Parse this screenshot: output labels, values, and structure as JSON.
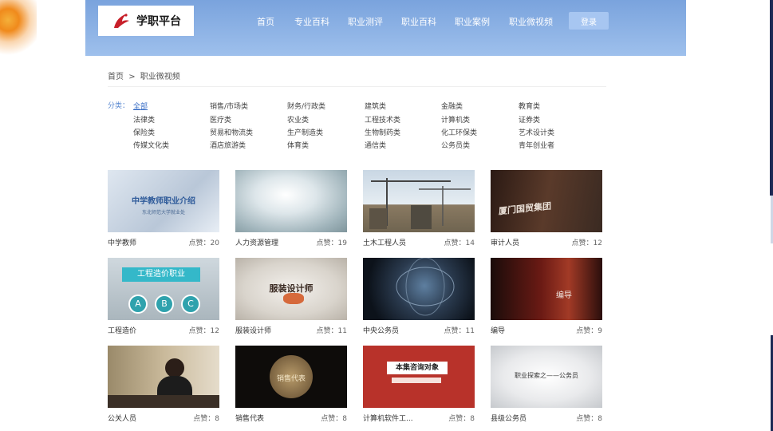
{
  "header": {
    "logo_text": "学职平台",
    "nav": [
      "首页",
      "专业百科",
      "职业测评",
      "职业百科",
      "职业案例",
      "职业微视频"
    ],
    "login_label": "登录"
  },
  "breadcrumb": {
    "home": "首页",
    "sep": ">",
    "current": "职业微视频"
  },
  "filter": {
    "label": "分类：",
    "categories": [
      [
        "全部",
        "销售/市场类",
        "财务/行政类",
        "建筑类",
        "金融类",
        "教育类"
      ],
      [
        "法律类",
        "医疗类",
        "农业类",
        "工程技术类",
        "计算机类",
        "证券类"
      ],
      [
        "保险类",
        "贸易和物流类",
        "生产制造类",
        "生物制药类",
        "化工环保类",
        "艺术设计类"
      ],
      [
        "传媒文化类",
        "酒店旅游类",
        "体育类",
        "通信类",
        "公务员类",
        "青年创业者"
      ]
    ]
  },
  "videos": [
    {
      "title": "中学教师",
      "likes": "点赞：20",
      "thumb_text": "中学教师职业介绍",
      "thumb_sub": "东北师范大学就业处"
    },
    {
      "title": "人力资源管理",
      "likes": "点赞：19",
      "thumb_text": "",
      "thumb_sub": ""
    },
    {
      "title": "土木工程人员",
      "likes": "点赞：14",
      "thumb_text": "",
      "thumb_sub": ""
    },
    {
      "title": "审计人员",
      "likes": "点赞：12",
      "thumb_text": "厦门国贸集团",
      "thumb_sub": ""
    },
    {
      "title": "工程造价",
      "likes": "点赞：12",
      "thumb_text": "工程造价职业",
      "thumb_sub": ""
    },
    {
      "title": "服装设计师",
      "likes": "点赞：11",
      "thumb_text": "服装设计师",
      "thumb_sub": ""
    },
    {
      "title": "中央公务员",
      "likes": "点赞：11",
      "thumb_text": "",
      "thumb_sub": ""
    },
    {
      "title": "编导",
      "likes": "点赞：9",
      "thumb_text": "编导",
      "thumb_sub": ""
    },
    {
      "title": "公关人员",
      "likes": "点赞：8",
      "thumb_text": "",
      "thumb_sub": ""
    },
    {
      "title": "销售代表",
      "likes": "点赞：8",
      "thumb_text": "销售代表",
      "thumb_sub": ""
    },
    {
      "title": "计算机软件工...",
      "likes": "点赞：8",
      "thumb_text": "本集咨询对象",
      "thumb_sub": ""
    },
    {
      "title": "县级公务员",
      "likes": "点赞：8",
      "thumb_text": "职业探索之——公务员",
      "thumb_sub": ""
    }
  ],
  "abc_labels": [
    "A",
    "B",
    "C"
  ]
}
